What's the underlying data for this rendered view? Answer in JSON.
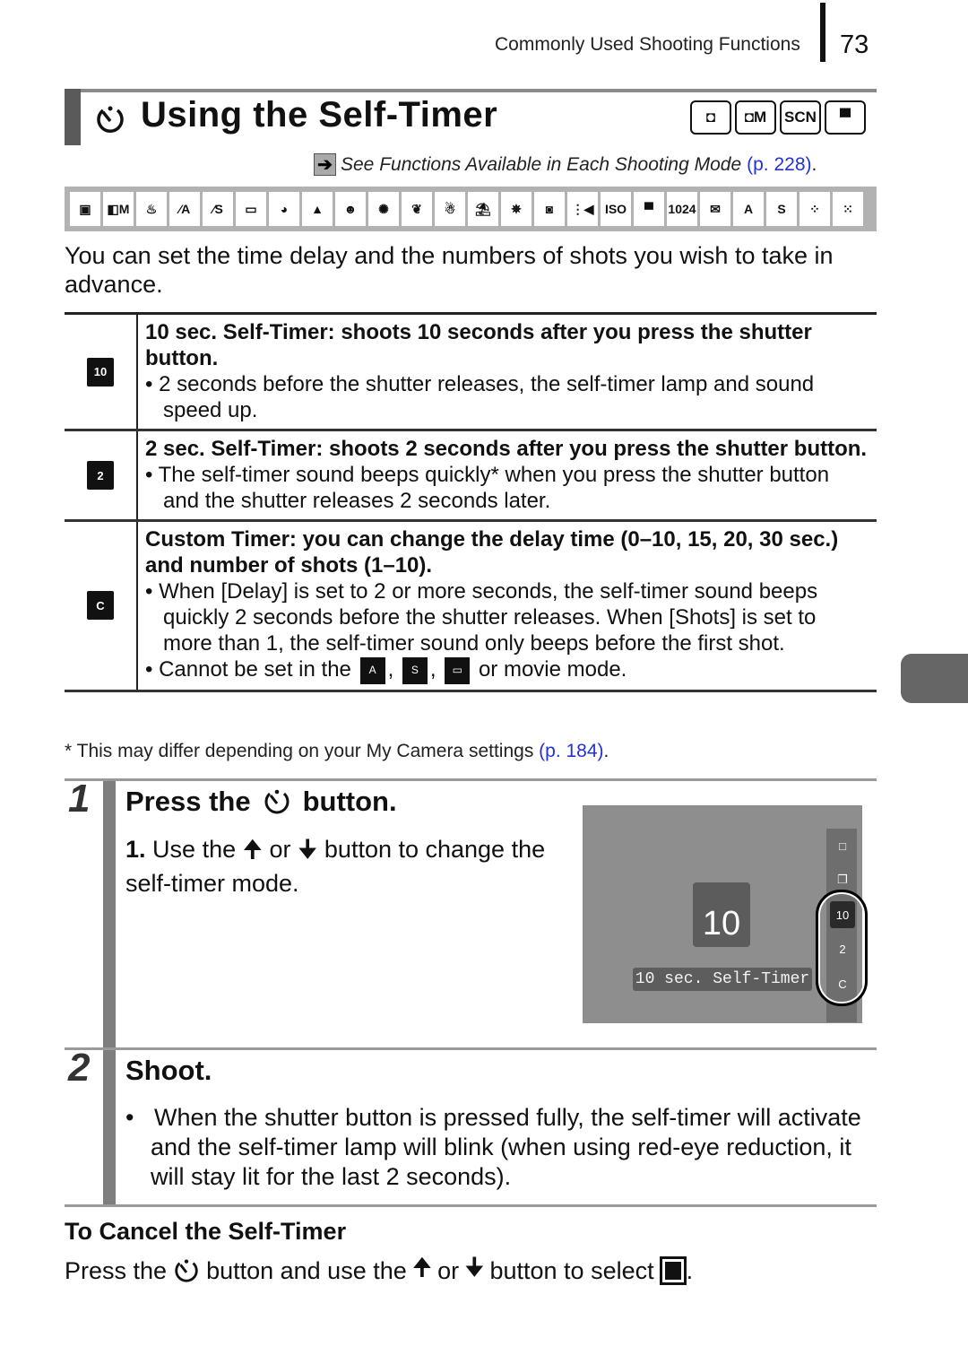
{
  "header": {
    "section": "Commonly Used Shooting Functions",
    "page_number": "73"
  },
  "title": {
    "icon": "self-timer-icon",
    "text": "Using the Self-Timer",
    "mode_badges": [
      {
        "icon": "camera-auto-icon",
        "label": "◘"
      },
      {
        "icon": "camera-manual-icon",
        "label": "◘M"
      },
      {
        "icon": "scene-icon",
        "label": "SCN"
      },
      {
        "icon": "movie-icon",
        "label": "▀"
      }
    ]
  },
  "see_reference": {
    "prefix": "See ",
    "italic": "Functions Available in Each Shooting Mode",
    "link": "(p. 228)",
    "suffix": "."
  },
  "mode_icons": [
    {
      "name": "auto",
      "glyph": "▣"
    },
    {
      "name": "manual",
      "glyph": "◧M"
    },
    {
      "name": "digital-macro",
      "glyph": "♨"
    },
    {
      "name": "color-accent",
      "glyph": "⁄A"
    },
    {
      "name": "color-swap",
      "glyph": "⁄S"
    },
    {
      "name": "stitch-assist",
      "glyph": "▭"
    },
    {
      "name": "portrait",
      "glyph": "◕"
    },
    {
      "name": "night-snapshot",
      "glyph": "▲"
    },
    {
      "name": "kids-pets",
      "glyph": "☻"
    },
    {
      "name": "indoor",
      "glyph": "✺"
    },
    {
      "name": "foliage",
      "glyph": "❦"
    },
    {
      "name": "snow",
      "glyph": "☃"
    },
    {
      "name": "beach",
      "glyph": "⛱"
    },
    {
      "name": "fireworks",
      "glyph": "✵"
    },
    {
      "name": "aquarium",
      "glyph": "◙"
    },
    {
      "name": "underwater",
      "glyph": "⋮◀"
    },
    {
      "name": "iso-3200",
      "glyph": "ISO"
    },
    {
      "name": "movie-standard",
      "glyph": "▀"
    },
    {
      "name": "movie-1024",
      "glyph": "1024"
    },
    {
      "name": "movie-email",
      "glyph": "✉"
    },
    {
      "name": "movie-color-accent",
      "glyph": "A"
    },
    {
      "name": "movie-color-swap",
      "glyph": "S"
    },
    {
      "name": "movie-time-lapse",
      "glyph": "⁘"
    },
    {
      "name": "extra",
      "glyph": "⁙"
    }
  ],
  "intro": "You can set the time delay and the numbers of shots you wish to take in advance.",
  "timer_modes": [
    {
      "icon": "self-timer-10-icon",
      "icon_label": "10",
      "heading": "10 sec. Self-Timer: shoots 10 seconds after you press the shutter button.",
      "bullets": [
        "2 seconds before the shutter releases, the self-timer lamp and sound speed up."
      ]
    },
    {
      "icon": "self-timer-2-icon",
      "icon_label": "2",
      "heading": "2 sec. Self-Timer: shoots 2 seconds after you press the shutter button.",
      "bullets": [
        "The self-timer sound beeps quickly* when you press the shutter button and the shutter releases 2 seconds later."
      ]
    },
    {
      "icon": "custom-timer-icon",
      "icon_label": "C",
      "heading": "Custom Timer: you can change the delay time (0–10, 15, 20, 30 sec.) and number of shots (1–10).",
      "bullets": [
        "When [Delay] is set to 2 or more seconds, the self-timer sound beeps quickly 2 seconds before the shutter releases. When [Shots] is set to more than 1, the self-timer sound only beeps before the first shot."
      ],
      "last_bullet": {
        "prefix": "Cannot be set in the",
        "icon1": "A",
        "icon2": "S",
        "icon3": "▭",
        "suffix": "or movie mode."
      }
    }
  ],
  "footnote": {
    "text": "* This may differ depending on your My Camera settings ",
    "link": "(p. 184)",
    "suffix": "."
  },
  "steps": [
    {
      "number": "1",
      "title_prefix": "Press the",
      "title_suffix": "button.",
      "substep_num": "1.",
      "substep_text_a": "Use the",
      "substep_or": "or",
      "substep_text_b": "button to change the self-timer mode."
    },
    {
      "number": "2",
      "title": "Shoot.",
      "bullet": "When the shutter button is pressed fully, the self-timer will activate and the self-timer lamp will blink (when using red-eye reduction, it will stay lit for the last 2 seconds)."
    }
  ],
  "lcd": {
    "big_icon_label": "10",
    "label": "10 sec. Self-Timer",
    "options": [
      {
        "name": "single-shot",
        "glyph": "□",
        "selected": false
      },
      {
        "name": "continuous",
        "glyph": "❐",
        "selected": false
      },
      {
        "name": "timer-10",
        "glyph": "10",
        "selected": true
      },
      {
        "name": "timer-2",
        "glyph": "2",
        "selected": false
      },
      {
        "name": "timer-custom",
        "glyph": "C",
        "selected": false
      }
    ]
  },
  "cancel": {
    "title": "To Cancel the Self-Timer",
    "text_a": "Press the",
    "text_b": "button and use the",
    "text_or": "or",
    "text_c": "button to select",
    "text_end": "."
  }
}
